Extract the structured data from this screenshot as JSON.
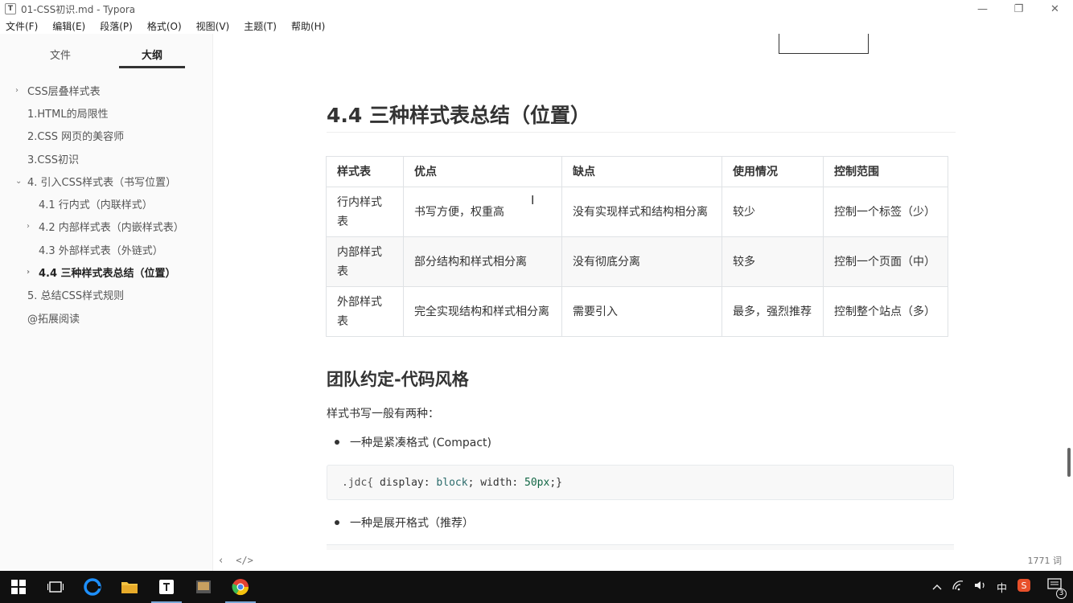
{
  "window": {
    "title": "01-CSS初识.md - Typora",
    "app_icon": "T",
    "minimize_glyph": "—",
    "restore_glyph": "❐",
    "close_glyph": "✕"
  },
  "menu": [
    "文件(F)",
    "编辑(E)",
    "段落(P)",
    "格式(O)",
    "视图(V)",
    "主题(T)",
    "帮助(H)"
  ],
  "sidebar": {
    "tab_files": "文件",
    "tab_outline": "大纲",
    "outline": [
      {
        "label": "CSS层叠样式表",
        "level": 1,
        "chevron": "›"
      },
      {
        "label": "1.HTML的局限性",
        "level": 1,
        "chevron": ""
      },
      {
        "label": "2.CSS 网页的美容师",
        "level": 1,
        "chevron": ""
      },
      {
        "label": "3.CSS初识",
        "level": 1,
        "chevron": ""
      },
      {
        "label": "4. 引入CSS样式表（书写位置）",
        "level": 1,
        "chevron": "⌄"
      },
      {
        "label": "4.1 行内式（内联样式）",
        "level": 2,
        "chevron": ""
      },
      {
        "label": "4.2 内部样式表（内嵌样式表）",
        "level": 2,
        "chevron": "›"
      },
      {
        "label": "4.3 外部样式表（外链式）",
        "level": 2,
        "chevron": ""
      },
      {
        "label": "4.4 三种样式表总结（位置）",
        "level": 2,
        "chevron": "›",
        "active": true
      },
      {
        "label": "5. 总结CSS样式规则",
        "level": 1,
        "chevron": ""
      },
      {
        "label": "@拓展阅读",
        "level": 1,
        "chevron": ""
      }
    ]
  },
  "editor": {
    "heading": "4.4 三种样式表总结（位置）",
    "table": {
      "headers": [
        "样式表",
        "优点",
        "缺点",
        "使用情况",
        "控制范围"
      ],
      "rows": [
        [
          "行内样式表",
          "书写方便，权重高",
          "没有实现样式和结构相分离",
          "较少",
          "控制一个标签（少）"
        ],
        [
          "内部样式表",
          "部分结构和样式相分离",
          "没有彻底分离",
          "较多",
          "控制一个页面（中）"
        ],
        [
          "外部样式表",
          "完全实现结构和样式相分离",
          "需要引入",
          "最多，强烈推荐",
          "控制整个站点（多）"
        ]
      ]
    },
    "subheading": "团队约定-代码风格",
    "paragraph": "样式书写一般有两种：",
    "bullet1": "一种是紧凑格式 (Compact)",
    "code": {
      "selector": ".jdc{ ",
      "prop1": "display",
      "val1": "block",
      "prop2": "width",
      "num": "50px",
      "end": ";}"
    },
    "bullet2": "一种是展开格式（推荐）"
  },
  "status": {
    "back": "‹",
    "source": "</>",
    "word_count": "1771 词"
  },
  "taskbar": {
    "tray_ime": "中",
    "tray_notify": "3"
  }
}
